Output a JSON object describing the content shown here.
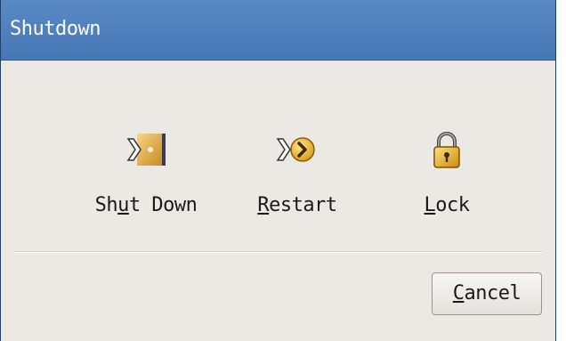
{
  "window": {
    "title": "Shutdown"
  },
  "actions": [
    {
      "label_pre": "Sh",
      "label_key": "u",
      "label_post": "t Down",
      "icon": "shutdown-icon"
    },
    {
      "label_pre": "",
      "label_key": "R",
      "label_post": "estart",
      "icon": "restart-icon"
    },
    {
      "label_pre": "",
      "label_key": "L",
      "label_post": "ock",
      "icon": "lock-icon"
    }
  ],
  "footer": {
    "cancel_pre": "",
    "cancel_key": "C",
    "cancel_post": "ancel"
  }
}
